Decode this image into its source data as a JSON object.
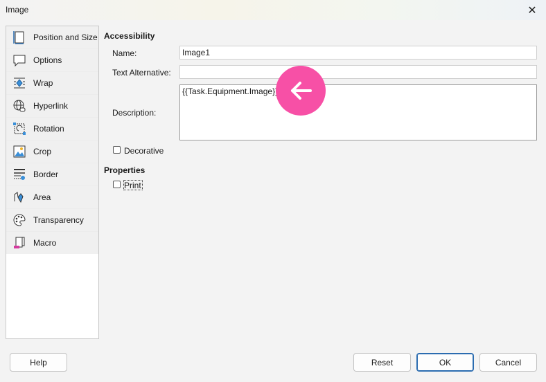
{
  "window": {
    "title": "Image"
  },
  "sidebar": {
    "items": [
      {
        "label": "Position and Size",
        "icon": "position-size-icon"
      },
      {
        "label": "Options",
        "icon": "options-icon"
      },
      {
        "label": "Wrap",
        "icon": "wrap-icon"
      },
      {
        "label": "Hyperlink",
        "icon": "hyperlink-icon"
      },
      {
        "label": "Rotation",
        "icon": "rotation-icon"
      },
      {
        "label": "Crop",
        "icon": "crop-icon"
      },
      {
        "label": "Border",
        "icon": "border-icon"
      },
      {
        "label": "Area",
        "icon": "area-icon"
      },
      {
        "label": "Transparency",
        "icon": "transparency-icon"
      },
      {
        "label": "Macro",
        "icon": "macro-icon"
      }
    ]
  },
  "accessibility": {
    "heading": "Accessibility",
    "name_label": "Name:",
    "name_value": "Image1",
    "alt_label": "Text Alternative:",
    "alt_value": "",
    "desc_label": "Description:",
    "desc_value": "{{Task.Equipment.Image}}",
    "decorative_label": "Decorative",
    "decorative_checked": false
  },
  "properties": {
    "heading": "Properties",
    "print_label": "Print",
    "print_checked": false
  },
  "buttons": {
    "help": "Help",
    "reset": "Reset",
    "ok": "OK",
    "cancel": "Cancel"
  }
}
